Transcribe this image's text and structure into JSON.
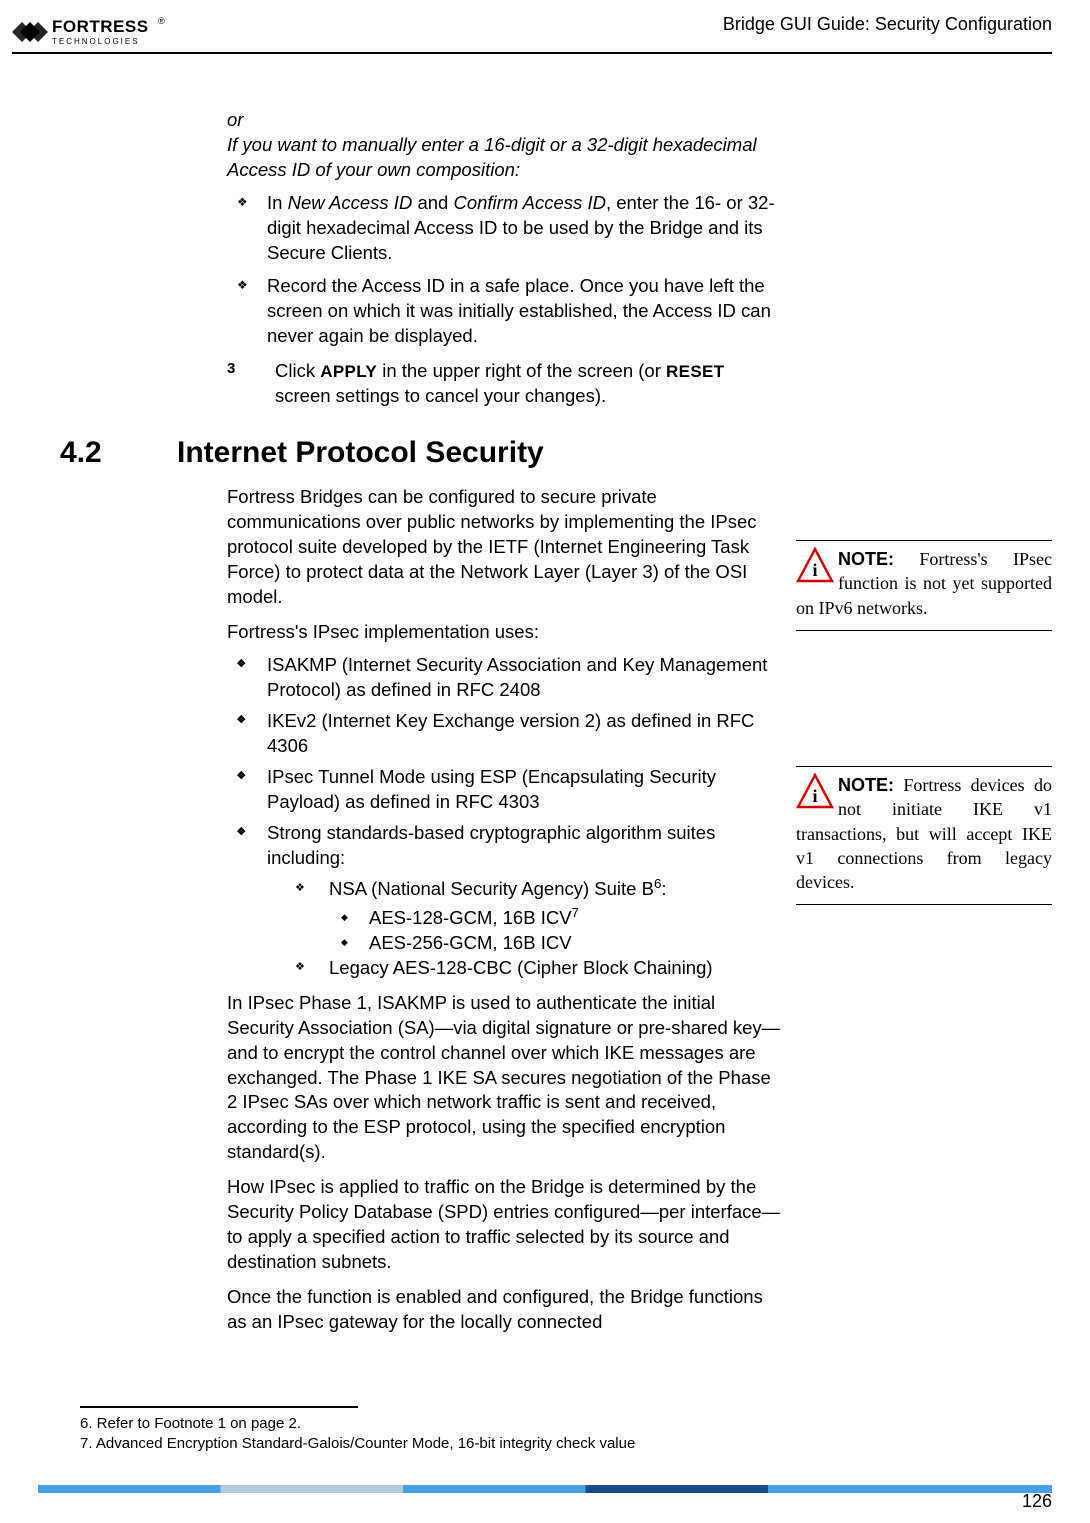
{
  "header": {
    "title": "Bridge GUI Guide: Security Configuration",
    "logo_brand": "FORTRESS",
    "logo_sub": "TECHNOLOGIES",
    "logo_reg": "®"
  },
  "intro": {
    "or": "or",
    "manual_prompt": "If you want to manually enter a 16-digit or a 32-digit hexadecimal Access ID of your own composition:",
    "bullet1_a": "In ",
    "bullet1_b": "New Access ID",
    "bullet1_c": " and ",
    "bullet1_d": "Confirm Access ID",
    "bullet1_e": ", enter the 16- or 32-digit hexadecimal Access ID to be used by the Bridge and its Secure Clients.",
    "bullet2": "Record the Access ID in a safe place. Once you have left the screen on which it was initially established, the Access ID can never again be displayed."
  },
  "step3": {
    "num": "3",
    "a": "Click ",
    "apply": "APPLY",
    "b": " in the upper right of the screen (or ",
    "reset": "RESET",
    "c": " screen settings to cancel your changes)."
  },
  "section": {
    "num": "4.2",
    "title": "Internet Protocol Security",
    "p1": "Fortress Bridges can be configured to secure private communications over public networks by implementing the IPsec protocol suite developed by the IETF (Internet Engineering Task Force) to protect data at the Network Layer (Layer 3) of the OSI model.",
    "p2": "Fortress's IPsec implementation uses:",
    "li1": "ISAKMP (Internet Security Association and Key Management Protocol) as defined in RFC 2408",
    "li2": "IKEv2 (Internet Key Exchange version 2) as defined in RFC 4306",
    "li3": "IPsec Tunnel Mode using ESP (Encapsulating Security Payload) as defined in RFC 4303",
    "li4": "Strong standards-based cryptographic algorithm suites including:",
    "li4a_a": "NSA (National Security Agency) Suite B",
    "li4a_fn": "6",
    "li4a_b": ":",
    "li4a_i_a": "AES-128-GCM, 16B ICV",
    "li4a_i_fn": "7",
    "li4a_ii": "AES-256-GCM, 16B ICV",
    "li4b": "Legacy AES-128-CBC (Cipher Block Chaining)",
    "p3": "In IPsec Phase 1, ISAKMP is used to authenticate the initial Security Association (SA)—via digital signature or pre-shared key—and to encrypt the control channel over which IKE messages are exchanged. The Phase 1 IKE SA secures negotiation of the Phase 2 IPsec SAs over which network traffic is sent and received, according to the ESP protocol, using the specified encryption standard(s).",
    "p4": "How IPsec is applied to traffic on the Bridge is determined by the Security Policy Database (SPD) entries configured—per interface—to apply a specified action to traffic selected by its source and destination subnets.",
    "p5": "Once the function is enabled and configured, the Bridge functions as an IPsec gateway for the locally connected"
  },
  "notes": {
    "label": "NOTE:",
    "n1": " Fortress's IPsec function is not yet supported on IPv6 networks.",
    "n2": " Fortress devices do not initiate IKE v1 transactions, but will accept IKE v1 connections from legacy devices."
  },
  "footnotes": {
    "f6": "6. Refer to Footnote 1 on page 2.",
    "f7": "7. Advanced Encryption Standard-Galois/Counter Mode, 16-bit integrity check value"
  },
  "page_num": "126"
}
